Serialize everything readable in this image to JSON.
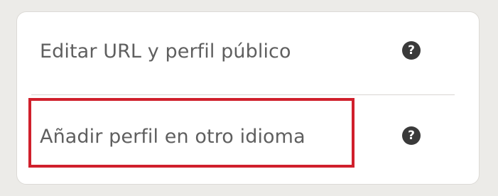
{
  "settings": {
    "items": [
      {
        "label": "Editar URL y perfil público",
        "help_icon": "question-circle-icon"
      },
      {
        "label": "Añadir perfil en otro idioma",
        "help_icon": "question-circle-icon"
      }
    ],
    "highlight_color": "#d0202c",
    "help_glyph": "?"
  }
}
